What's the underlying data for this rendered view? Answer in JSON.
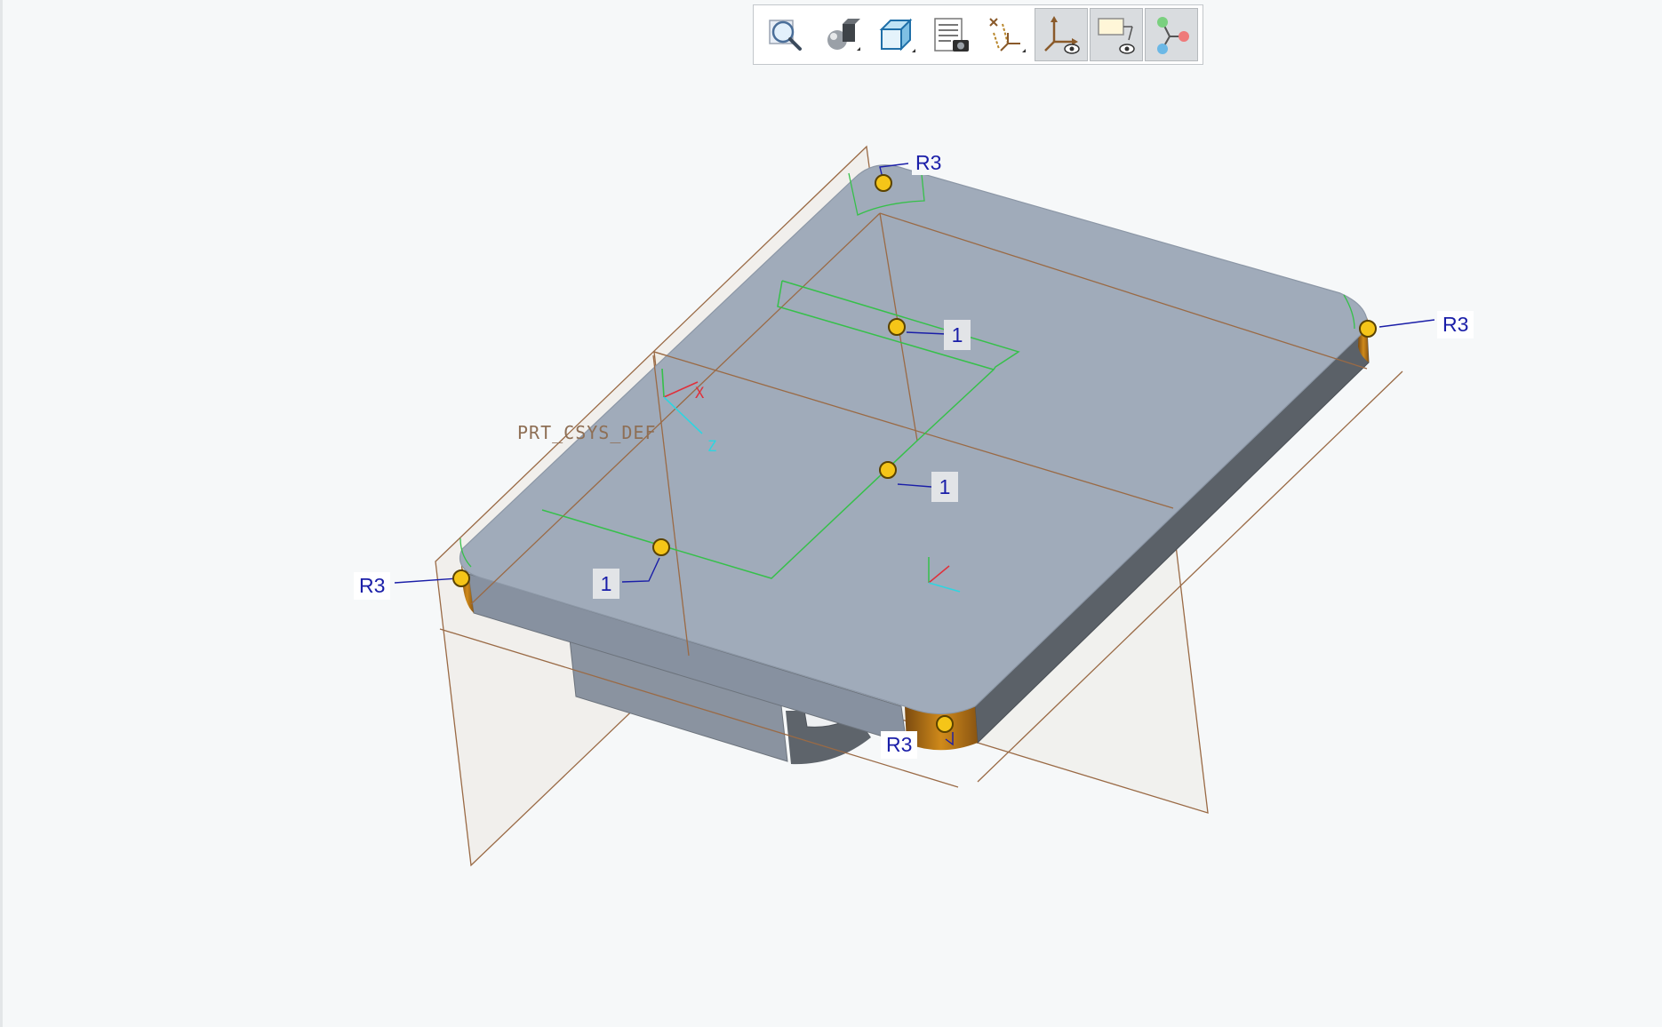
{
  "toolbar": {
    "buttons": [
      {
        "icon": "zoom-magnifier-icon",
        "active": false
      },
      {
        "icon": "display-style-icon",
        "active": false
      },
      {
        "icon": "saved-orientations-icon",
        "active": false
      },
      {
        "icon": "view-manager-icon",
        "active": false
      },
      {
        "icon": "datum-display-filters-icon",
        "active": false
      },
      {
        "icon": "csys-display-icon",
        "active": true
      },
      {
        "icon": "annotation-display-icon",
        "active": true
      },
      {
        "icon": "spin-center-icon",
        "active": true
      }
    ]
  },
  "annotations": {
    "radius_top": "R3",
    "radius_right": "R3",
    "radius_left": "R3",
    "radius_bottom": "R3",
    "value_top": "1",
    "value_middle": "1",
    "value_left": "1"
  },
  "csys": {
    "name": "PRT_CSYS_DEF",
    "x_axis": "X",
    "z_axis": "Z"
  },
  "colors": {
    "background": "#f6f8f9",
    "part_top": "#a0abba",
    "part_side": "#5b6168",
    "part_front": "#8690a0",
    "datum_plane_edge": "#9a6a45",
    "round_highlight": "#b86a0e",
    "sketch_green": "#36c04a",
    "annotation_blue": "#1a1ea8",
    "handle_yellow": "#f5c518"
  }
}
